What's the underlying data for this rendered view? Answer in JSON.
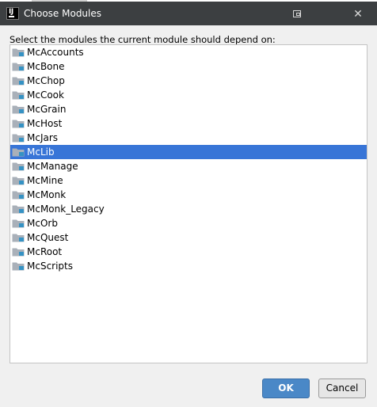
{
  "dialog": {
    "title": "Choose Modules",
    "app_icon_text": "IJ",
    "close_glyph": "✕"
  },
  "prompt": "Select the modules the current module should depend on:",
  "modules": [
    {
      "name": "McAccounts",
      "selected": false
    },
    {
      "name": "McBone",
      "selected": false
    },
    {
      "name": "McChop",
      "selected": false
    },
    {
      "name": "McCook",
      "selected": false
    },
    {
      "name": "McGrain",
      "selected": false
    },
    {
      "name": "McHost",
      "selected": false
    },
    {
      "name": "McJars",
      "selected": false
    },
    {
      "name": "McLib",
      "selected": true
    },
    {
      "name": "McManage",
      "selected": false
    },
    {
      "name": "McMine",
      "selected": false
    },
    {
      "name": "McMonk",
      "selected": false
    },
    {
      "name": "McMonk_Legacy",
      "selected": false
    },
    {
      "name": "McOrb",
      "selected": false
    },
    {
      "name": "McQuest",
      "selected": false
    },
    {
      "name": "McRoot",
      "selected": false
    },
    {
      "name": "McScripts",
      "selected": false
    }
  ],
  "buttons": {
    "ok_label": "OK",
    "cancel_label": "Cancel"
  },
  "colors": {
    "selection": "#3875d7",
    "folder": "#a9b0b9",
    "module_marker": "#3592c4",
    "ok_button": "#4a88c7"
  },
  "icons": {
    "module": "module-folder-icon",
    "restore": "restore-window-icon",
    "close": "close-icon",
    "app": "intellij-app-icon"
  }
}
